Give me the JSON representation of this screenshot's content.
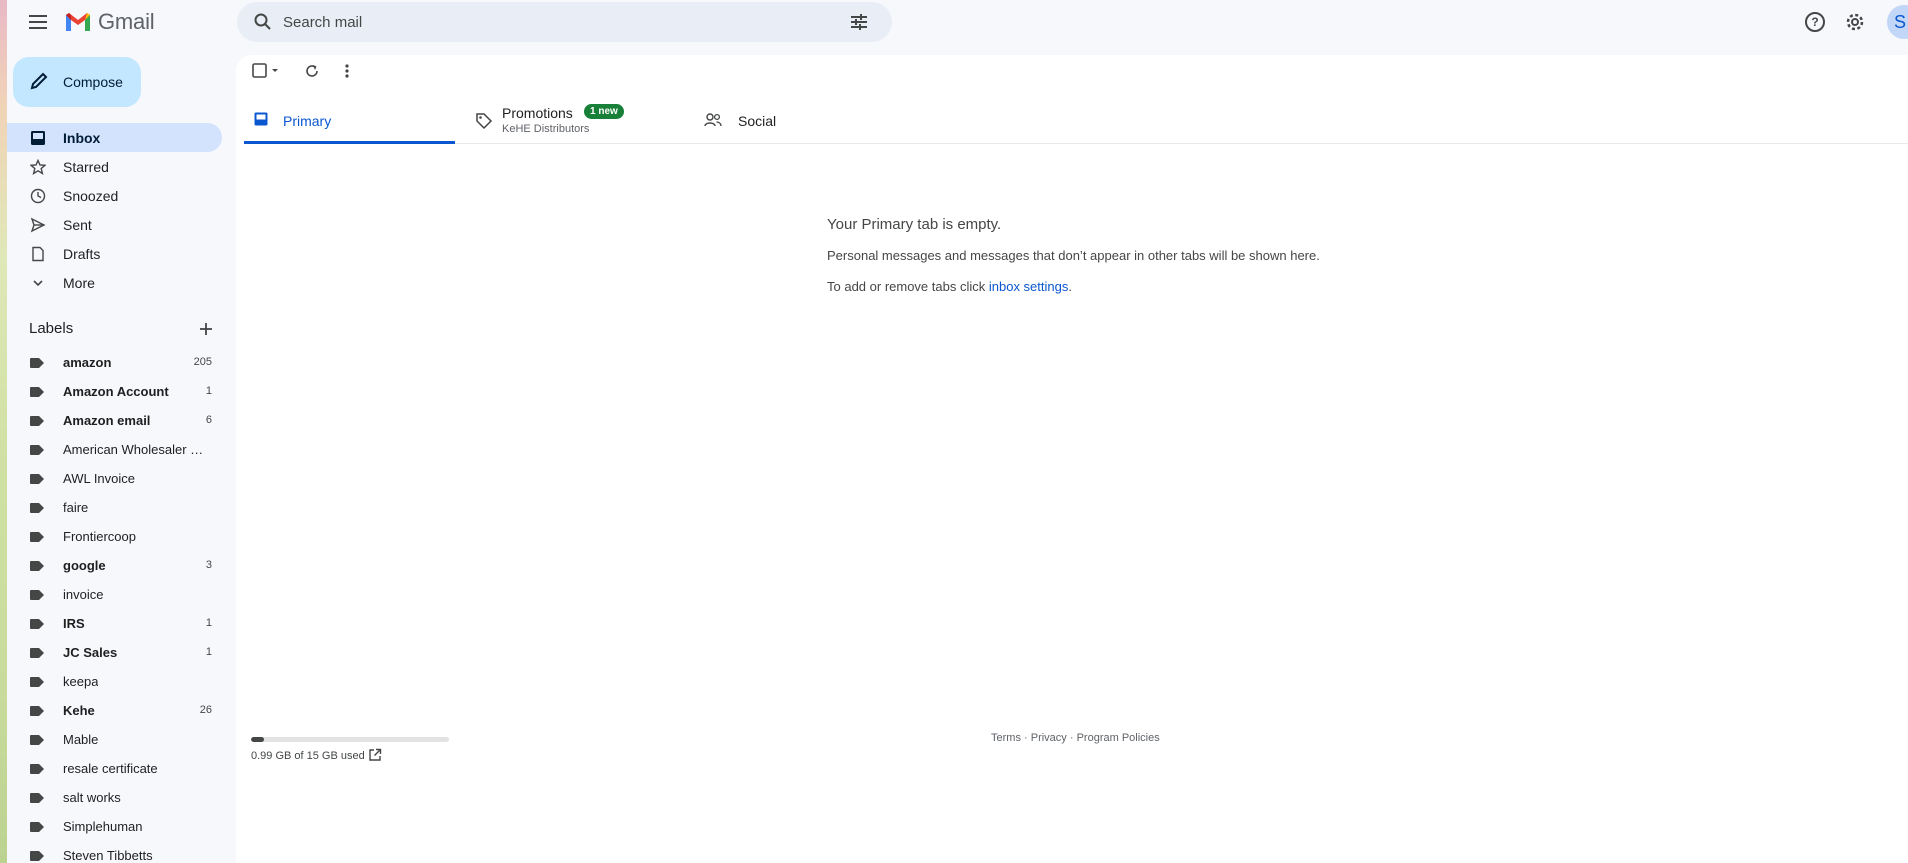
{
  "app": {
    "name": "Gmail"
  },
  "search": {
    "placeholder": "Search mail"
  },
  "compose": {
    "label": "Compose"
  },
  "nav": {
    "items": [
      {
        "label": "Inbox",
        "icon": "inbox-icon",
        "active": true
      },
      {
        "label": "Starred",
        "icon": "star-icon"
      },
      {
        "label": "Snoozed",
        "icon": "clock-icon"
      },
      {
        "label": "Sent",
        "icon": "send-icon"
      },
      {
        "label": "Drafts",
        "icon": "draft-icon"
      },
      {
        "label": "More",
        "icon": "chevron-down-icon"
      }
    ]
  },
  "labels": {
    "heading": "Labels",
    "items": [
      {
        "name": "amazon",
        "count": "205",
        "bold": true
      },
      {
        "name": "Amazon Account",
        "count": "1",
        "bold": true
      },
      {
        "name": "Amazon email",
        "count": "6",
        "bold": true
      },
      {
        "name": "American Wholesaler S...",
        "count": "",
        "bold": false
      },
      {
        "name": "AWL Invoice",
        "count": "",
        "bold": false
      },
      {
        "name": "faire",
        "count": "",
        "bold": false
      },
      {
        "name": "Frontiercoop",
        "count": "",
        "bold": false
      },
      {
        "name": "google",
        "count": "3",
        "bold": true
      },
      {
        "name": "invoice",
        "count": "",
        "bold": false
      },
      {
        "name": "IRS",
        "count": "1",
        "bold": true
      },
      {
        "name": "JC Sales",
        "count": "1",
        "bold": true
      },
      {
        "name": "keepa",
        "count": "",
        "bold": false
      },
      {
        "name": "Kehe",
        "count": "26",
        "bold": true
      },
      {
        "name": "Mable",
        "count": "",
        "bold": false
      },
      {
        "name": "resale certificate",
        "count": "",
        "bold": false
      },
      {
        "name": "salt works",
        "count": "",
        "bold": false
      },
      {
        "name": "Simplehuman",
        "count": "",
        "bold": false
      },
      {
        "name": "Steven Tibbetts",
        "count": "",
        "bold": false
      }
    ]
  },
  "tabs": {
    "primary": {
      "label": "Primary"
    },
    "promotions": {
      "label": "Promotions",
      "badge": "1 new",
      "subtitle": "KeHE Distributors"
    },
    "social": {
      "label": "Social"
    }
  },
  "empty": {
    "title": "Your Primary tab is empty.",
    "line1": "Personal messages and messages that don’t appear in other tabs will be shown here.",
    "line2_prefix": "To add or remove tabs click ",
    "line2_link": "inbox settings",
    "line2_suffix": "."
  },
  "storage": {
    "text": "0.99 GB of 15 GB used",
    "used_fraction": 0.066
  },
  "footer": {
    "terms": "Terms",
    "privacy": "Privacy",
    "policies": "Program Policies",
    "sep": " · "
  },
  "account": {
    "initial": "S"
  },
  "colors": {
    "accent": "#0b57d0",
    "active_nav": "#d3e3fd",
    "compose_bg": "#c2e7ff",
    "badge": "#188038"
  }
}
